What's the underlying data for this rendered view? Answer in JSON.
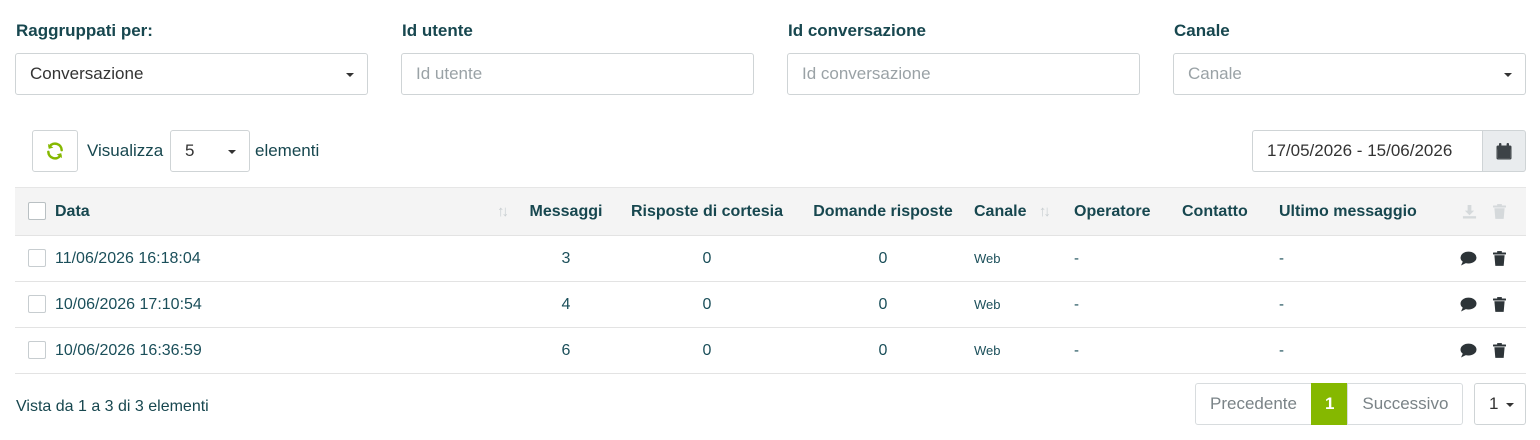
{
  "filters": {
    "group_by": {
      "label": "Raggruppati per:",
      "value": "Conversazione"
    },
    "user_id": {
      "label": "Id utente",
      "placeholder": "Id utente"
    },
    "conversation_id": {
      "label": "Id conversazione",
      "placeholder": "Id conversazione"
    },
    "channel": {
      "label": "Canale",
      "placeholder": "Canale"
    }
  },
  "toolbar": {
    "show_label": "Visualizza",
    "page_length": "5",
    "elements_label": "elementi",
    "date_range": "17/05/2026 - 15/06/2026",
    "refresh_icon": "refresh-icon",
    "calendar_icon": "calendar-icon"
  },
  "table": {
    "columns": {
      "data": "Data",
      "messaggi": "Messaggi",
      "risposte": "Risposte di cortesia",
      "domande": "Domande risposte",
      "canale": "Canale",
      "operatore": "Operatore",
      "contatto": "Contatto",
      "ultimo": "Ultimo messaggio"
    },
    "sort_icon": "↑↓",
    "rows": [
      {
        "data": "11/06/2026 16:18:04",
        "messaggi": "3",
        "risposte": "0",
        "domande": "0",
        "canale": "Web",
        "operatore": "-",
        "contatto": "",
        "ultimo": "-"
      },
      {
        "data": "10/06/2026 17:10:54",
        "messaggi": "4",
        "risposte": "0",
        "domande": "0",
        "canale": "Web",
        "operatore": "-",
        "contatto": "",
        "ultimo": "-"
      },
      {
        "data": "10/06/2026 16:36:59",
        "messaggi": "6",
        "risposte": "0",
        "domande": "0",
        "canale": "Web",
        "operatore": "-",
        "contatto": "",
        "ultimo": "-"
      }
    ]
  },
  "footer": {
    "info": "Vista da 1 a 3 di 3 elementi",
    "prev": "Precedente",
    "current_page": "1",
    "next": "Successivo",
    "page_select": "1"
  },
  "colors": {
    "accent": "#85b800",
    "text": "#17474f",
    "header_bg": "#f4f4f4"
  }
}
